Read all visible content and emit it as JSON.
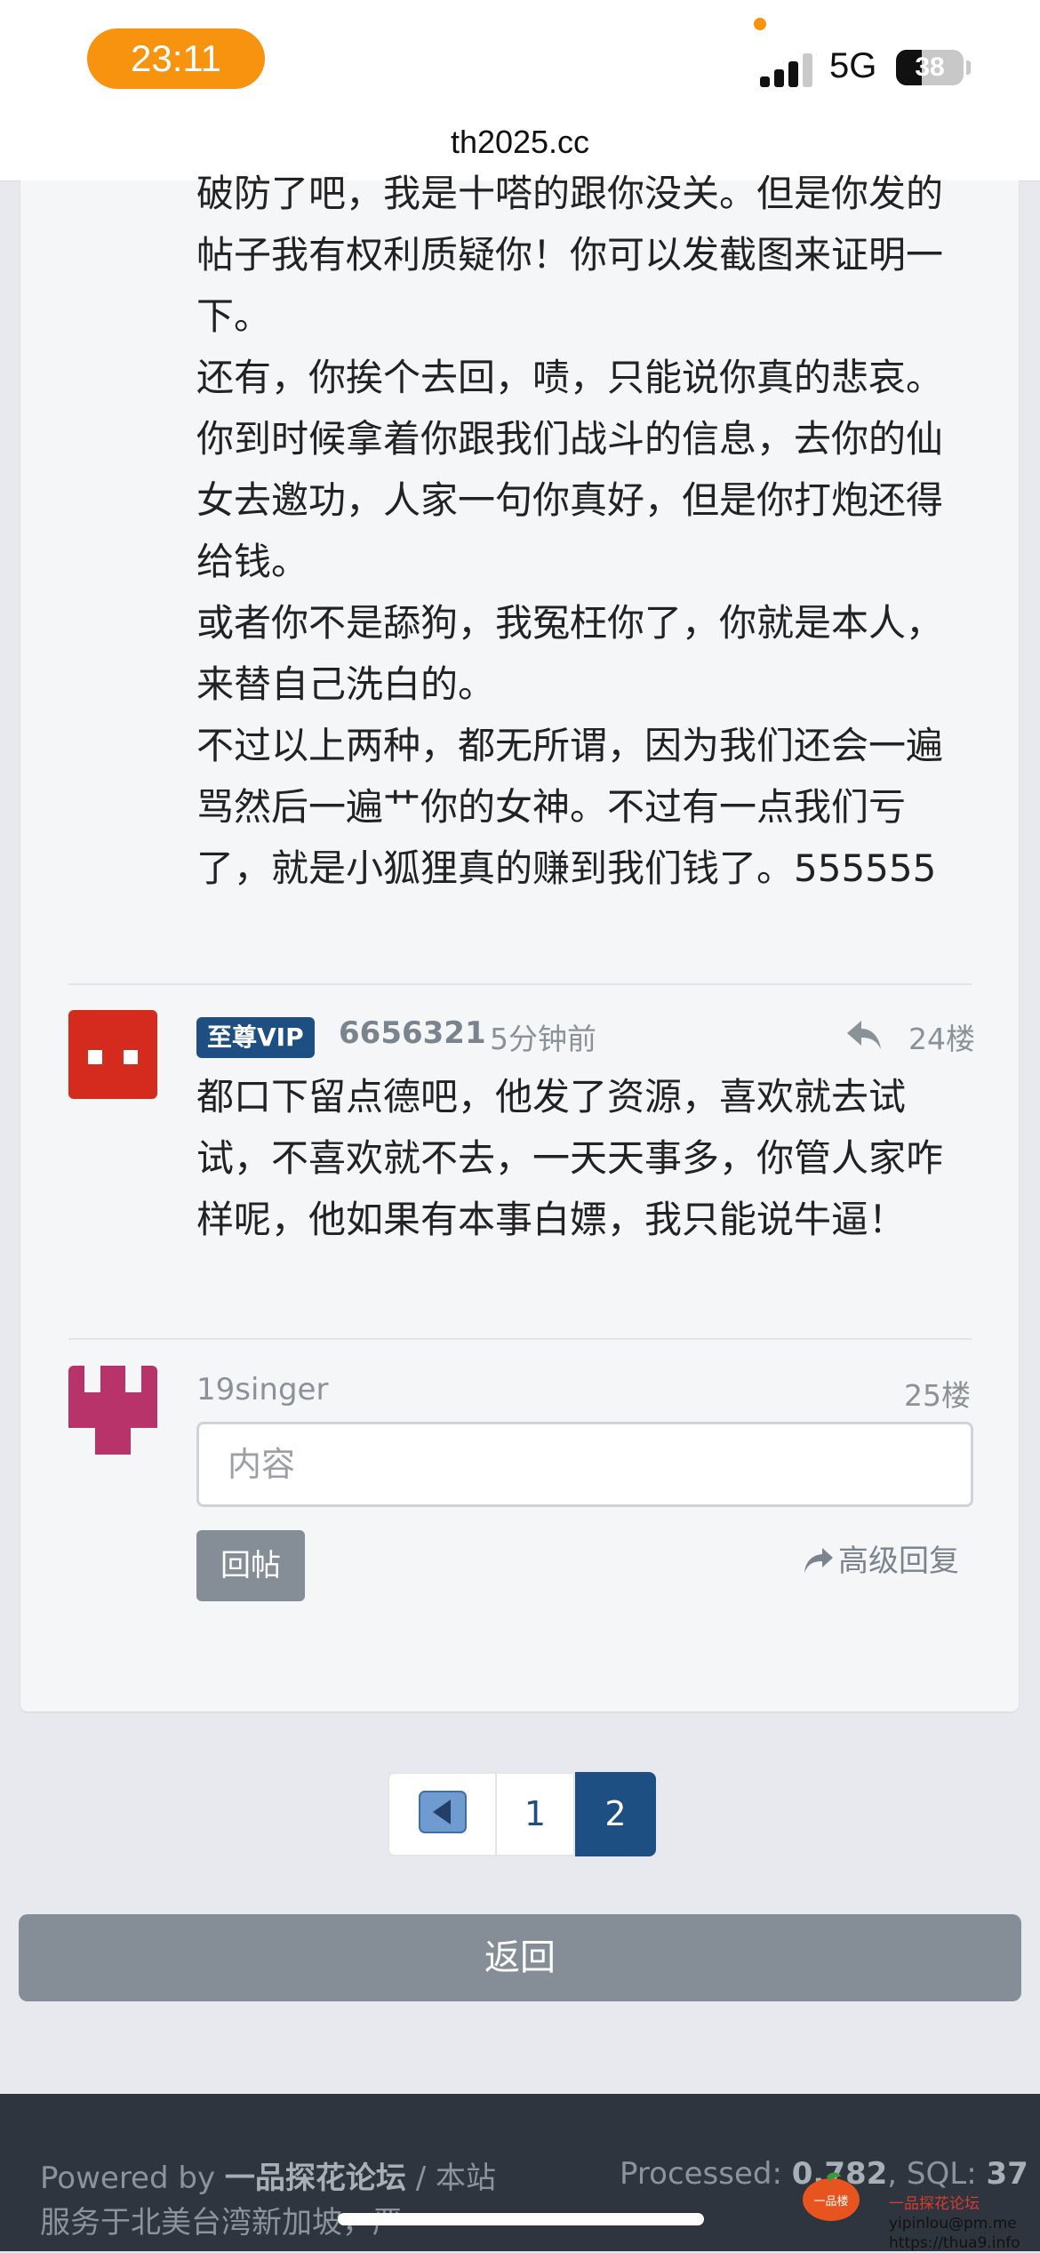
{
  "status_bar": {
    "time": "23:11",
    "network": "5G",
    "battery": "38",
    "battery_level": 0.38
  },
  "browser": {
    "url": "th2025.cc"
  },
  "previous_post": {
    "paragraphs": [
      "破防了吧，我是十嗒的跟你没关。但是你发的帖子我有权利质疑你！你可以发截图来证明一下。",
      "还有，你挨个去回，啧，只能说你真的悲哀。你到时候拿着你跟我们战斗的信息，去你的仙女去邀功，人家一句你真好，但是你打炮还得给钱。",
      "或者你不是舔狗，我冤枉你了，你就是本人，来替自己洗白的。",
      "不过以上两种，都无所谓，因为我们还会一遍骂然后一遍艹你的女神。不过有一点我们亏了，就是小狐狸真的赚到我们钱了。555555"
    ]
  },
  "reply": {
    "badge": "至尊VIP",
    "username": "6656321",
    "time": "5分钟前",
    "floor": "24楼",
    "content": "都口下留点德吧，他发了资源，喜欢就去试试，不喜欢就不去，一天天事多，你管人家咋样呢，他如果有本事白嫖，我只能说牛逼！",
    "avatar_color": "#d52a1e"
  },
  "compose": {
    "username": "19singer",
    "floor": "25楼",
    "placeholder": "内容",
    "submit_label": "回帖",
    "advanced_label": "高级回复",
    "avatar_color": "#b8336a"
  },
  "pagination": {
    "pages": [
      "1",
      "2"
    ],
    "current": "2"
  },
  "back_label": "返回",
  "footer": {
    "powered_by": "Powered by",
    "forum_name": "一品探花论坛",
    "sep_text": "/ 本站服务于北美台湾新加坡，严",
    "processed_label": "Processed:",
    "processed_value": "0.782",
    "sql_label": ", SQL:",
    "sql_value": "37"
  },
  "watermark": {
    "logo_text": "一品楼",
    "line1": "一品探花论坛",
    "line2": "yipinlou@pm.me",
    "line3": "https://thua9.info"
  },
  "colors": {
    "accent": "#1e4f82",
    "time_pill": "#f7930f",
    "button_gray": "#858d96",
    "footer_bg": "#2f353e"
  }
}
